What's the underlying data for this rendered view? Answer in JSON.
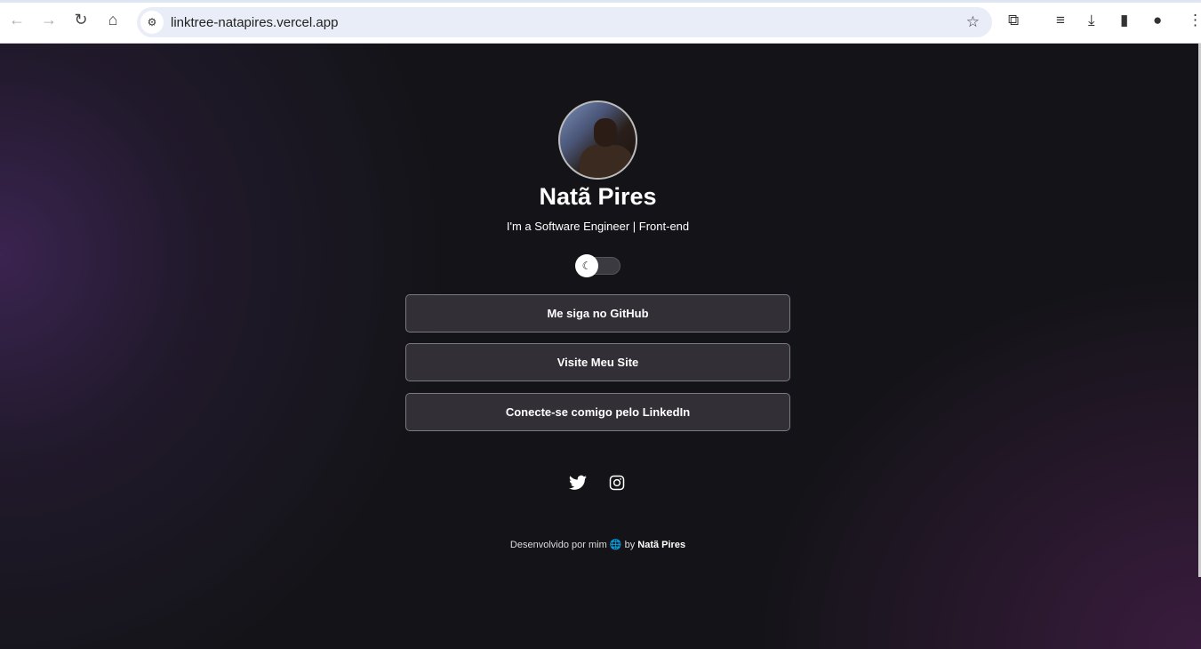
{
  "browser": {
    "url": "linktree-natapires.vercel.app"
  },
  "profile": {
    "name": "Natã Pires",
    "bio": "I'm a Software Engineer | Front-end"
  },
  "theme_toggle": {
    "icon": "moon-stars-icon",
    "state": "dark"
  },
  "links": [
    {
      "label": "Me siga no GitHub"
    },
    {
      "label": "Visite Meu Site"
    },
    {
      "label": "Conecte-se comigo pelo LinkedIn"
    }
  ],
  "social": [
    {
      "icon": "twitter-icon"
    },
    {
      "icon": "instagram-icon"
    }
  ],
  "footer": {
    "text": "Desenvolvido por mim",
    "globe": "🌐",
    "by": "by",
    "author": "Natã Pires"
  }
}
